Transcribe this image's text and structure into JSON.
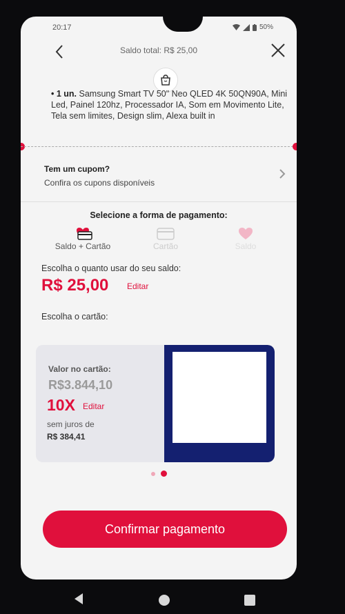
{
  "status": {
    "time": "20:17",
    "battery": "50%"
  },
  "header": {
    "title": "Saldo total: R$  25,00"
  },
  "product": {
    "quantity": "• 1 un.",
    "description": "Samsung Smart TV 50\" Neo QLED 4K 50QN90A, Mini Led, Painel 120hz, Processador IA, Som em Movimento Lite, Tela sem limites, Design slim, Alexa built in"
  },
  "coupon": {
    "title": "Tem um cupom?",
    "subtitle": "Confira os cupons disponíveis"
  },
  "payment": {
    "title": "Selecione a forma de pagamento:",
    "tabs": [
      {
        "label": "Saldo + Cartão"
      },
      {
        "label": "Cartão"
      },
      {
        "label": "Saldo"
      }
    ],
    "choose_amount": "Escolha o quanto usar do seu saldo:",
    "amount": "R$ 25,00",
    "edit": "Editar",
    "choose_card": "Escolha o cartão:"
  },
  "card": {
    "label": "Valor no cartão:",
    "value": "R$3.844,10",
    "installments": "10X",
    "edit": "Editar",
    "no_interest": "sem juros de",
    "installment_value": "R$  384,41"
  },
  "confirm_label": "Confirmar pagamento",
  "colors": {
    "accent": "#e0103c",
    "card_blue": "#142070"
  }
}
